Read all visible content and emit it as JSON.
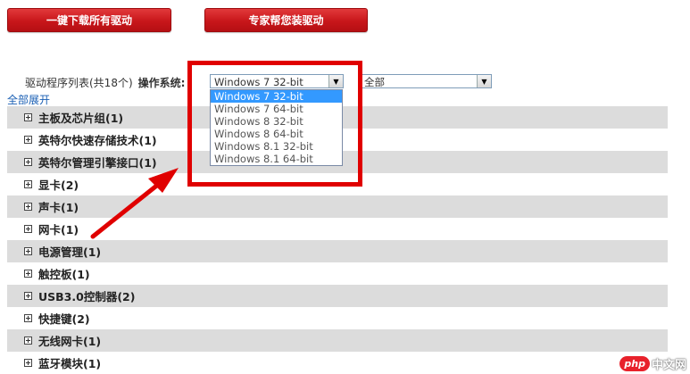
{
  "buttons": {
    "download_all": "一键下载所有驱动",
    "expert_install": "专家帮您装驱动"
  },
  "filter": {
    "list_label": "驱动程序列表(共18个)",
    "os_label": "操作系统:",
    "os_selected": "Windows 7 32-bit",
    "category_selected": "全部",
    "os_options": [
      "Windows 7 32-bit",
      "Windows 7 64-bit",
      "Windows 8 32-bit",
      "Windows 8 64-bit",
      "Windows 8.1 32-bit",
      "Windows 8.1 64-bit"
    ]
  },
  "expand_all": "全部展开",
  "categories": [
    "主板及芯片组(1)",
    "英特尔快速存储技术(1)",
    "英特尔管理引擎接口(1)",
    "显卡(2)",
    "声卡(1)",
    "网卡(1)",
    "电源管理(1)",
    "触控板(1)",
    "USB3.0控制器(2)",
    "快捷键(2)",
    "无线网卡(1)",
    "蓝牙模块(1)"
  ],
  "watermark": {
    "logo": "php",
    "site": "中文网"
  },
  "colors": {
    "button_red": "#c8161a",
    "highlight": "#e00000",
    "selected_option": "#3399ff",
    "row_alt": "#dcdcdc"
  }
}
